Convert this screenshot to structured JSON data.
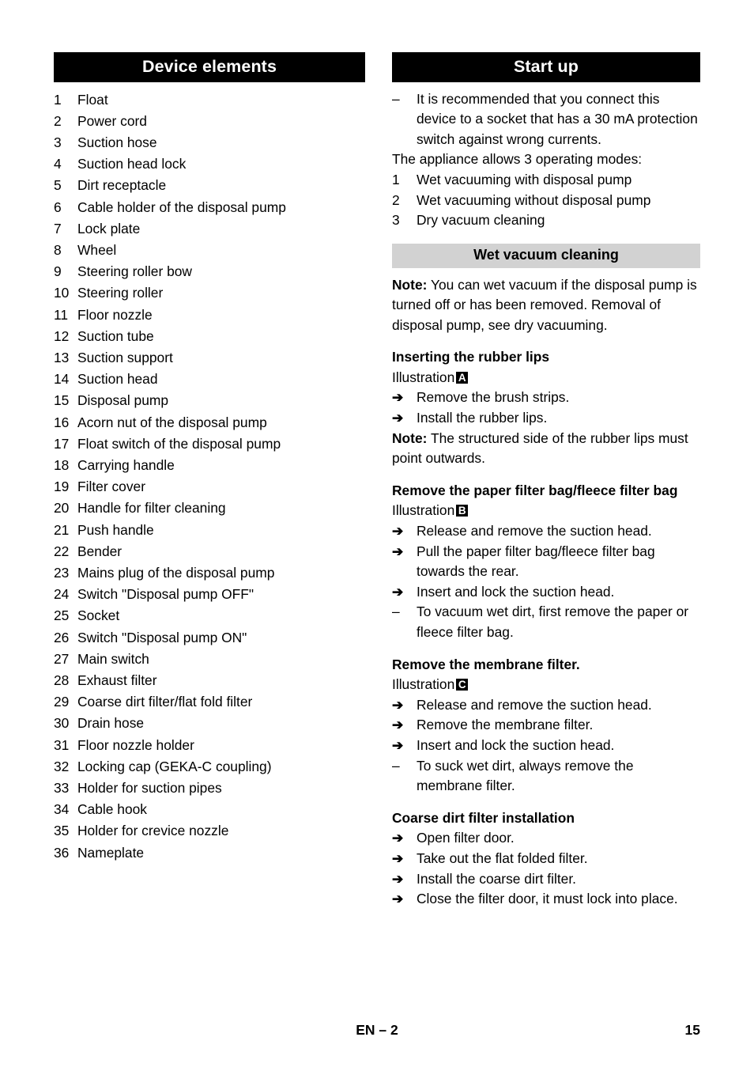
{
  "left_column": {
    "header": "Device elements",
    "elements": [
      {
        "num": "1",
        "label": "Float"
      },
      {
        "num": "2",
        "label": "Power cord"
      },
      {
        "num": "3",
        "label": "Suction hose"
      },
      {
        "num": "4",
        "label": "Suction head lock"
      },
      {
        "num": "5",
        "label": "Dirt receptacle"
      },
      {
        "num": "6",
        "label": "Cable holder of the disposal pump"
      },
      {
        "num": "7",
        "label": "Lock plate"
      },
      {
        "num": "8",
        "label": "Wheel"
      },
      {
        "num": "9",
        "label": "Steering roller bow"
      },
      {
        "num": "10",
        "label": "Steering roller"
      },
      {
        "num": "11",
        "label": "Floor nozzle"
      },
      {
        "num": "12",
        "label": "Suction tube"
      },
      {
        "num": "13",
        "label": "Suction support"
      },
      {
        "num": "14",
        "label": "Suction head"
      },
      {
        "num": "15",
        "label": "Disposal pump"
      },
      {
        "num": "16",
        "label": "Acorn nut of the disposal pump"
      },
      {
        "num": "17",
        "label": "Float switch of the disposal pump"
      },
      {
        "num": "18",
        "label": "Carrying handle"
      },
      {
        "num": "19",
        "label": "Filter cover"
      },
      {
        "num": "20",
        "label": "Handle for filter cleaning"
      },
      {
        "num": "21",
        "label": "Push handle"
      },
      {
        "num": "22",
        "label": "Bender"
      },
      {
        "num": "23",
        "label": "Mains plug of the disposal pump"
      },
      {
        "num": "24",
        "label": "Switch \"Disposal pump OFF\""
      },
      {
        "num": "25",
        "label": "Socket"
      },
      {
        "num": "26",
        "label": "Switch \"Disposal pump ON\""
      },
      {
        "num": "27",
        "label": "Main switch"
      },
      {
        "num": "28",
        "label": "Exhaust filter"
      },
      {
        "num": "29",
        "label": "Coarse dirt filter/flat fold filter"
      },
      {
        "num": "30",
        "label": "Drain hose"
      },
      {
        "num": "31",
        "label": "Floor nozzle holder"
      },
      {
        "num": "32",
        "label": "Locking cap (GEKA-C coupling)"
      },
      {
        "num": "33",
        "label": "Holder for suction pipes"
      },
      {
        "num": "34",
        "label": "Cable hook"
      },
      {
        "num": "35",
        "label": "Holder for crevice nozzle"
      },
      {
        "num": "36",
        "label": "Nameplate"
      }
    ]
  },
  "right_column": {
    "header": "Start up",
    "dash_marker": "–",
    "arrow_marker": "➔",
    "intro_dash": "It is recommended that you connect this device to a socket that has a 30 mA protection switch against wrong currents.",
    "modes_intro": "The appliance allows 3 operating modes:",
    "modes": [
      {
        "num": "1",
        "label": "Wet vacuuming with disposal pump"
      },
      {
        "num": "2",
        "label": "Wet vacuuming without disposal pump"
      },
      {
        "num": "3",
        "label": "Dry vacuum cleaning"
      }
    ],
    "wet_vacuum_header": "Wet vacuum cleaning",
    "note_1_label": "Note:",
    "note_1_text": " You can wet vacuum if the disposal pump is turned off or has been removed. Removal of disposal pump, see dry vacuuming.",
    "rubber_lips": {
      "heading": "Inserting the rubber lips",
      "illustration_label": "Illustration",
      "illustration_letter": "A",
      "steps": [
        "Remove the brush strips.",
        "Install the rubber lips."
      ]
    },
    "note_2_label": "Note:",
    "note_2_text": " The structured side of the rubber lips must point outwards.",
    "paper_bag": {
      "heading": "Remove the paper filter bag/fleece filter bag",
      "illustration_label": "Illustration",
      "illustration_letter": "B",
      "steps": [
        "Release and remove the suction head.",
        "Pull the paper filter bag/fleece filter bag towards the rear.",
        "Insert and lock the suction head."
      ],
      "dash_note": "To vacuum wet dirt, first remove the paper or fleece filter bag."
    },
    "membrane": {
      "heading": "Remove the membrane filter.",
      "illustration_label": "Illustration",
      "illustration_letter": "C",
      "steps": [
        "Release and remove the suction head.",
        "Remove the membrane filter.",
        "Insert and lock the suction head."
      ],
      "dash_note": "To suck wet dirt, always remove the membrane filter."
    },
    "coarse_filter": {
      "heading": "Coarse dirt filter installation",
      "steps": [
        "Open filter door.",
        "Take out the flat folded filter.",
        "Install the coarse dirt filter.",
        "Close the filter door, it must lock into place."
      ]
    }
  },
  "footer": {
    "center": "EN – 2",
    "page_number": "15"
  }
}
